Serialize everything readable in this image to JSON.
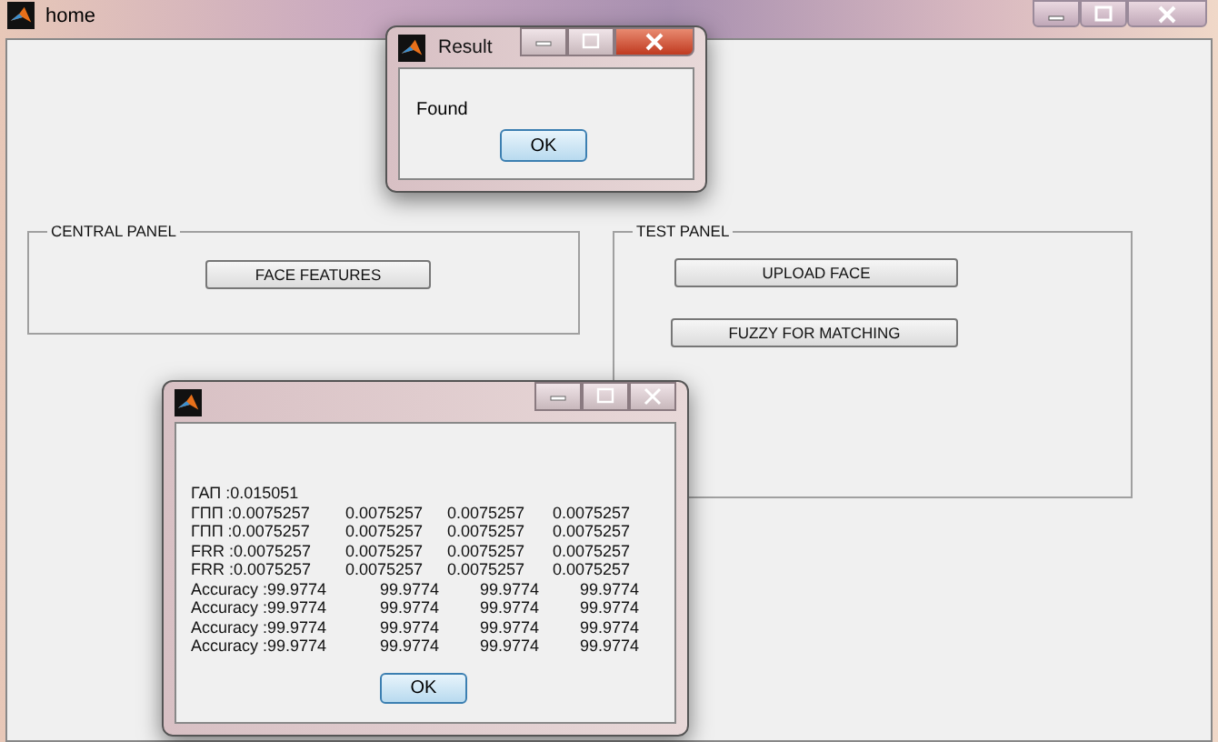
{
  "main_window": {
    "title": "home",
    "panels": [
      {
        "title": "CENTRAL PANEL",
        "kind": "central",
        "buttons": [
          "FACE FEATURES"
        ]
      },
      {
        "title": "TEST PANEL",
        "kind": "test",
        "buttons": [
          "UPLOAD FACE",
          "FUZZY FOR MATCHING"
        ]
      }
    ]
  },
  "result_dialog": {
    "title": "Result",
    "message": "Found",
    "button": "OK"
  },
  "output_dialog": {
    "rows": [
      {
        "kind": "single",
        "cells": [
          "ГАП :0.015051"
        ]
      },
      {
        "kind": "rate",
        "cells": [
          "ГПП :0.0075257",
          "0.0075257",
          "0.0075257",
          "0.0075257"
        ]
      },
      {
        "kind": "rate",
        "cells": [
          "ГПП :0.0075257",
          "0.0075257",
          "0.0075257",
          "0.0075257"
        ]
      },
      {
        "kind": "rate",
        "cells": [
          "FRR :0.0075257",
          "0.0075257",
          "0.0075257",
          "0.0075257"
        ]
      },
      {
        "kind": "rate",
        "cells": [
          "FRR :0.0075257",
          "0.0075257",
          "0.0075257",
          "0.0075257"
        ]
      },
      {
        "kind": "accuracy",
        "cells": [
          "Accuracy :99.9774",
          "99.9774",
          "99.9774",
          "99.9774"
        ]
      },
      {
        "kind": "accuracy",
        "cells": [
          "Accuracy :99.9774",
          "99.9774",
          "99.9774",
          "99.9774"
        ]
      },
      {
        "kind": "accuracy",
        "cells": [
          "Accuracy :99.9774",
          "99.9774",
          "99.9774",
          "99.9774"
        ]
      },
      {
        "kind": "accuracy",
        "cells": [
          "Accuracy :99.9774",
          "99.9774",
          "99.9774",
          "99.9774"
        ]
      }
    ],
    "button": "OK"
  }
}
